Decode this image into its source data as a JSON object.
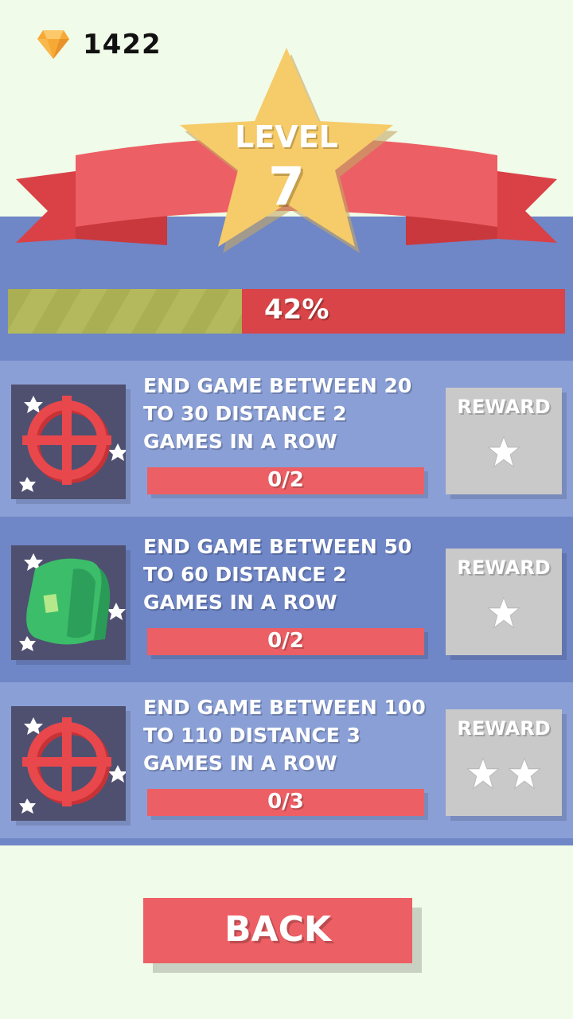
{
  "header": {
    "gem_icon": "diamond-icon",
    "gem_count": "1422"
  },
  "level": {
    "title": "LEVEL",
    "number": "7",
    "progress_text": "42%",
    "progress_value": 0.42
  },
  "quests": [
    {
      "icon": "crosshair-icon",
      "description": "END GAME BETWEEN 20 TO 30 DISTANCE 2 GAMES IN A ROW",
      "progress": "0/2",
      "reward_label": "REWARD",
      "reward_stars": 1
    },
    {
      "icon": "backpack-icon",
      "description": "END GAME BETWEEN 50 TO 60 DISTANCE 2 GAMES IN A ROW",
      "progress": "0/2",
      "reward_label": "REWARD",
      "reward_stars": 1
    },
    {
      "icon": "crosshair-icon",
      "description": "END GAME BETWEEN 100 TO 110 DISTANCE 3 GAMES IN A ROW",
      "progress": "0/3",
      "reward_label": "REWARD",
      "reward_stars": 2
    }
  ],
  "back_label": "BACK",
  "colors": {
    "background": "#f0fbe9",
    "band": "#6f86c7",
    "row_light": "#8a9fd6",
    "accent_red": "#ec5f64",
    "ribbon": "#e94f55",
    "star": "#f6cb69",
    "progress_fill": "#a9af52"
  }
}
